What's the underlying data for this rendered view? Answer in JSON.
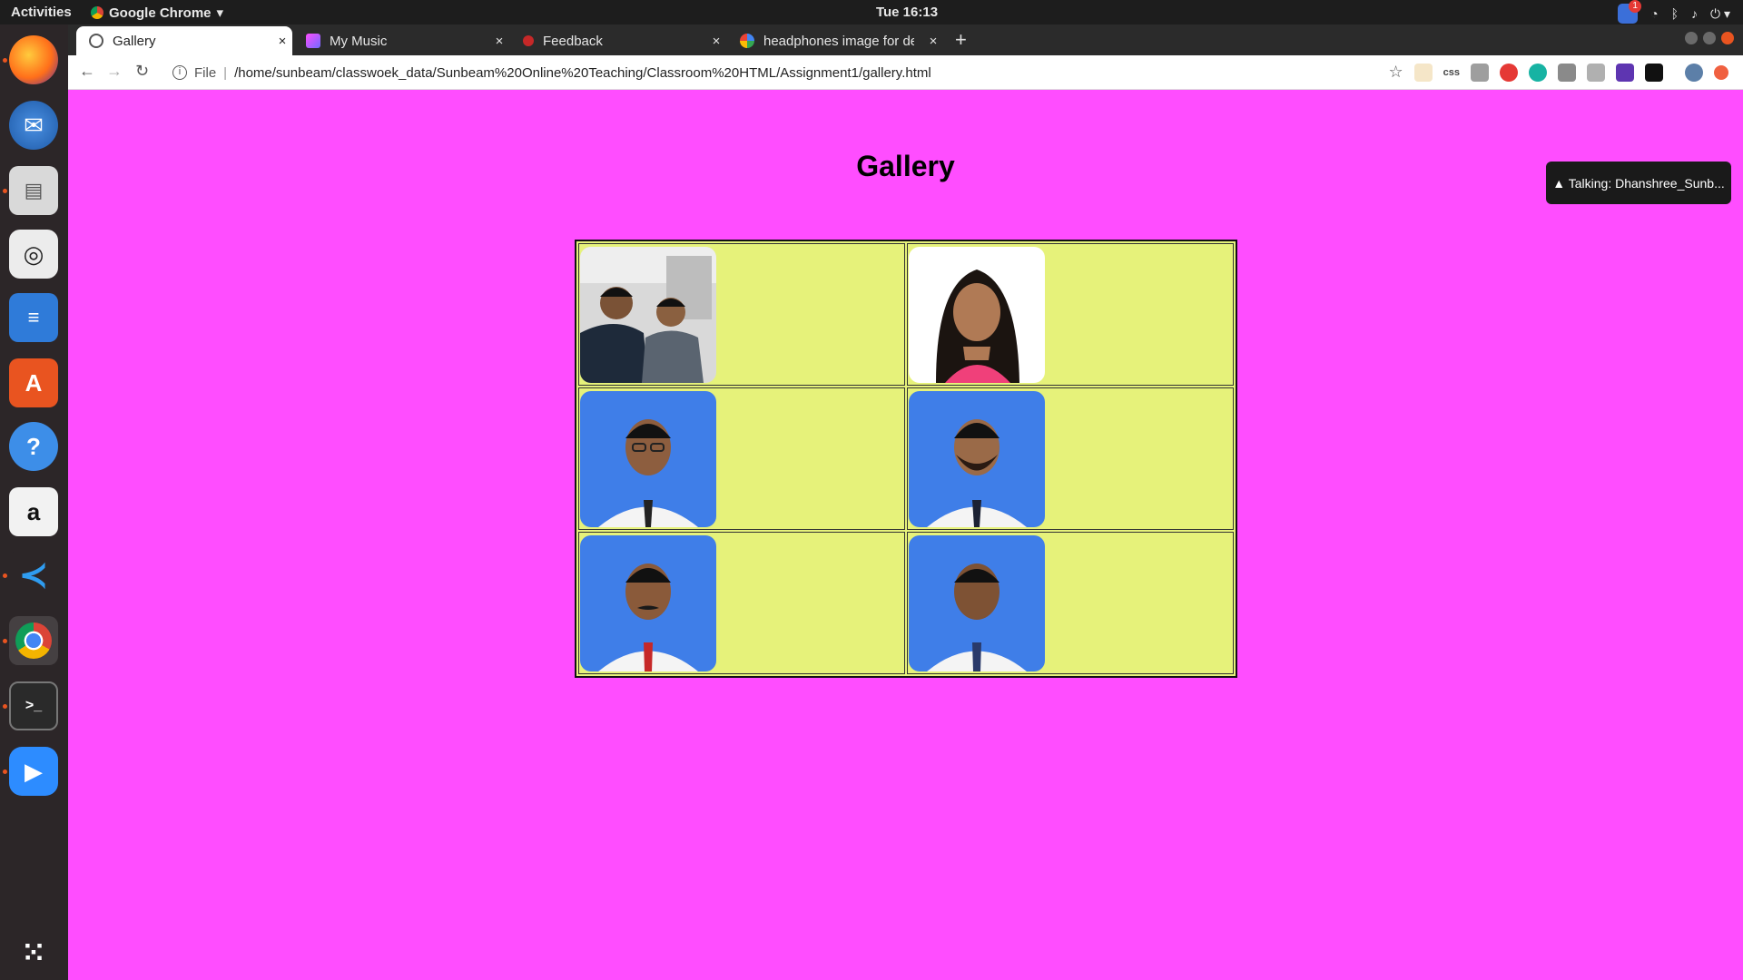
{
  "system": {
    "activities_label": "Activities",
    "app_menu_label": "Google Chrome",
    "clock": "Tue 16:13",
    "notification_count": "1"
  },
  "dock": {
    "items": [
      "firefox-icon",
      "thunderbird-icon",
      "files-icon",
      "rhythmbox-icon",
      "libreoffice-writer-icon",
      "software-center-icon",
      "help-icon",
      "amazon-icon",
      "vscode-icon",
      "chrome-icon",
      "terminal-icon",
      "zoom-icon",
      "app-grid-icon"
    ]
  },
  "browser": {
    "tabs": [
      {
        "title": "Gallery",
        "active": true
      },
      {
        "title": "My Music",
        "active": false
      },
      {
        "title": "Feedback",
        "active": false
      },
      {
        "title": "headphones image for de",
        "active": false
      }
    ],
    "close_glyph": "×",
    "newtab_glyph": "+",
    "address_prefix": "File",
    "separator": "|",
    "url": "/home/sunbeam/classwoek_data/Sunbeam%20Online%20Teaching/Classroom%20HTML/Assignment1/gallery.html"
  },
  "page": {
    "title": "Gallery",
    "gallery": [
      {
        "photo": "photo-two-men-selfie",
        "bg": "#d9d9d9"
      },
      {
        "photo": "photo-woman-portrait",
        "bg": "#ffffff"
      },
      {
        "photo": "photo-man-glasses",
        "bg": "#3f7ee8"
      },
      {
        "photo": "photo-man-beard",
        "bg": "#3f7ee8"
      },
      {
        "photo": "photo-man-mustache-red-tie",
        "bg": "#3f7ee8"
      },
      {
        "photo": "photo-man-blue-tie",
        "bg": "#3f7ee8"
      }
    ],
    "background_color": "#ff4dff",
    "table_color": "#e6f27a"
  },
  "zoom_indicator": {
    "text": "▲ Talking: Dhanshree_Sunb..."
  }
}
